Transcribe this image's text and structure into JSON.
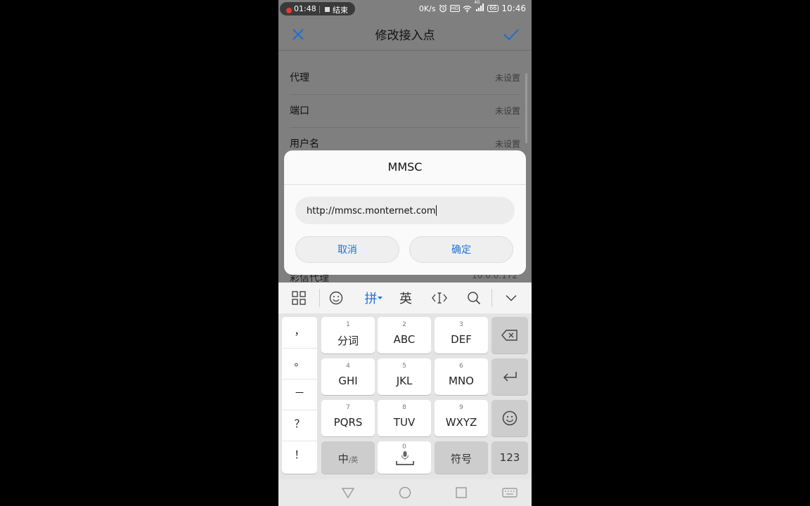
{
  "status_bar": {
    "record_time": "01:48",
    "record_end": "结束",
    "net_speed": "0K/s",
    "hd_label": "HD",
    "signal_label": "4G",
    "battery": "66",
    "clock": "10:46"
  },
  "header": {
    "title": "修改接入点",
    "close_icon": "close-icon",
    "confirm_icon": "check-icon"
  },
  "settings_rows": [
    {
      "label": "代理",
      "value": "未设置"
    },
    {
      "label": "端口",
      "value": "未设置"
    },
    {
      "label": "用户名",
      "value": "未设置"
    }
  ],
  "partial_row": {
    "label": "彩信代理",
    "value": "10.0.0.172"
  },
  "dialog": {
    "title": "MMSC",
    "input_value": "http://mmsc.monternet.com",
    "cancel_label": "取消",
    "ok_label": "确定"
  },
  "ime_toolbar": {
    "pinyin_label": "拼",
    "english_label": "英",
    "accent_color": "#1e72d6"
  },
  "keyboard": {
    "side_keys": [
      "，",
      "。",
      "－",
      "？",
      "！"
    ],
    "rows": [
      [
        {
          "num": "1",
          "label": "分词"
        },
        {
          "num": "2",
          "label": "ABC"
        },
        {
          "num": "3",
          "label": "DEF"
        }
      ],
      [
        {
          "num": "4",
          "label": "GHI"
        },
        {
          "num": "5",
          "label": "JKL"
        },
        {
          "num": "6",
          "label": "MNO"
        }
      ],
      [
        {
          "num": "7",
          "label": "PQRS"
        },
        {
          "num": "8",
          "label": "TUV"
        },
        {
          "num": "9",
          "label": "WXYZ"
        }
      ]
    ],
    "bottom": {
      "zh_label": "中",
      "en_sub": "/英",
      "space_num": "0",
      "symbol_label": "符号",
      "num_label": "123"
    }
  }
}
